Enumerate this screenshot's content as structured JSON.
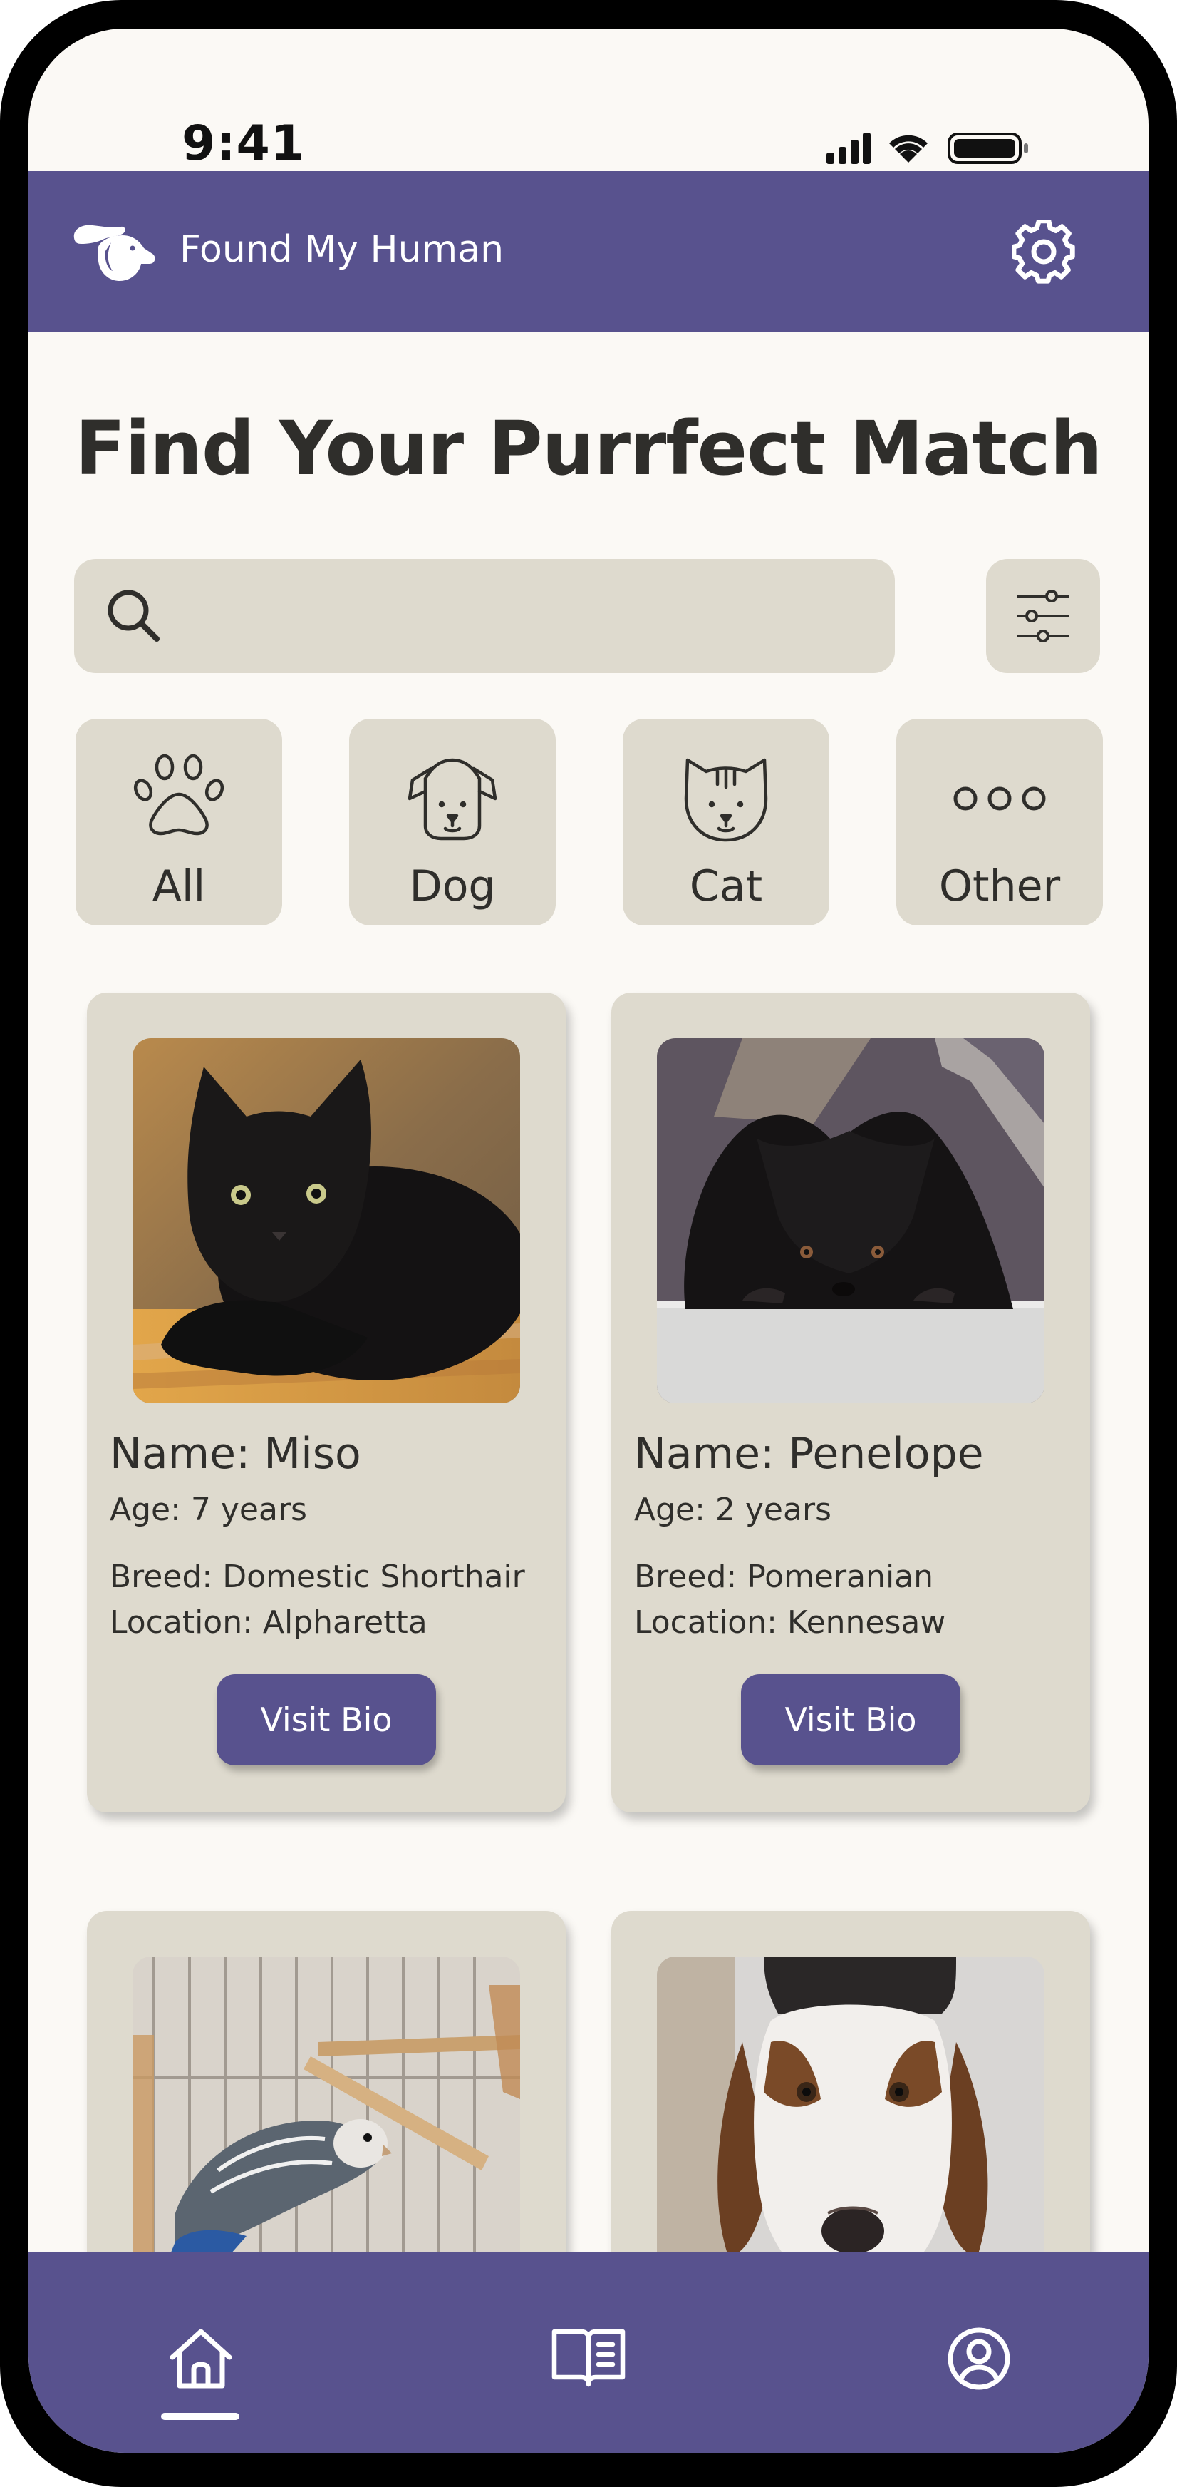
{
  "status_bar": {
    "time": "9:41",
    "signal_icon": "cellular-signal-icon",
    "wifi_icon": "wifi-icon",
    "battery_icon": "battery-icon"
  },
  "header": {
    "logo_icon": "dog-hand-logo-icon",
    "app_name": "Found My Human",
    "settings_icon": "gear-icon"
  },
  "page_title": "Find Your Purrfect Match",
  "search": {
    "placeholder": "",
    "value": "",
    "icon": "search-icon",
    "filter_icon": "sliders-icon"
  },
  "categories": [
    {
      "label": "All",
      "icon": "paw-icon"
    },
    {
      "label": "Dog",
      "icon": "dog-face-icon"
    },
    {
      "label": "Cat",
      "icon": "cat-face-icon"
    },
    {
      "label": "Other",
      "icon": "three-dots-icon"
    }
  ],
  "pets": [
    {
      "name": "Name: Miso",
      "age": "Age: 7 years",
      "breed": "Breed: Domestic Shorthair",
      "location": "Location: Alpharetta",
      "button": "Visit Bio",
      "photo": "black-cat-photo"
    },
    {
      "name": "Name: Penelope",
      "age": "Age: 2 years",
      "breed": "Breed: Pomeranian",
      "location": "Location: Kennesaw",
      "button": "Visit Bio",
      "photo": "black-pomeranian-photo"
    },
    {
      "photo": "budgie-in-cage-photo"
    },
    {
      "photo": "basset-hound-photo"
    }
  ],
  "bottom_nav": [
    {
      "icon": "home-icon",
      "active": true
    },
    {
      "icon": "book-icon",
      "active": false
    },
    {
      "icon": "user-circle-icon",
      "active": false
    }
  ],
  "colors": {
    "brand": "#58528e",
    "card": "#dedace",
    "background": "#fbf9f5",
    "text": "#2f2e2b"
  }
}
